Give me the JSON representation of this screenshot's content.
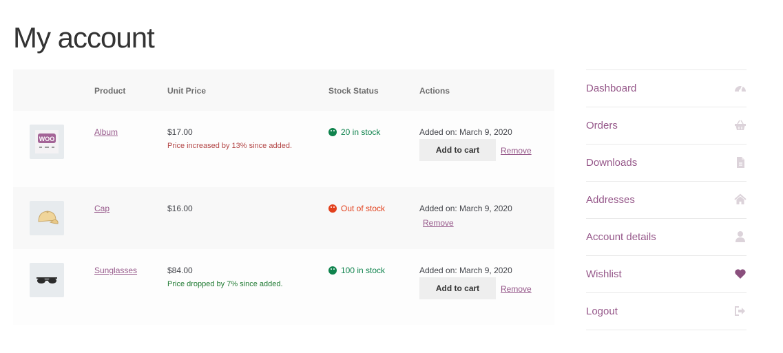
{
  "page": {
    "title": "My account"
  },
  "table": {
    "headers": {
      "product": "Product",
      "unit_price": "Unit Price",
      "stock_status": "Stock Status",
      "actions": "Actions"
    },
    "rows": [
      {
        "image_icon": "album-thumbnail",
        "product": "Album",
        "price": "$17.00",
        "price_note": "Price increased by 13% since added.",
        "stock": "20 in stock",
        "stock_state": "in",
        "added": "Added on: March 9, 2020",
        "add_to_cart": "Add to cart",
        "remove": "Remove"
      },
      {
        "image_icon": "cap-thumbnail",
        "product": "Cap",
        "price": "$16.00",
        "price_note": "",
        "stock": "Out of stock",
        "stock_state": "out",
        "added": "Added on: March 9, 2020",
        "remove": "Remove"
      },
      {
        "image_icon": "sunglasses-thumbnail",
        "product": "Sunglasses",
        "price": "$84.00",
        "price_note": "Price dropped by 7% since added.",
        "stock": "100 in stock",
        "stock_state": "in",
        "added": "Added on: March 9, 2020",
        "add_to_cart": "Add to cart",
        "remove": "Remove"
      }
    ]
  },
  "nav": {
    "items": [
      {
        "label": "Dashboard",
        "icon": "dashboard-icon"
      },
      {
        "label": "Orders",
        "icon": "basket-icon"
      },
      {
        "label": "Downloads",
        "icon": "file-icon"
      },
      {
        "label": "Addresses",
        "icon": "home-icon"
      },
      {
        "label": "Account details",
        "icon": "user-icon"
      },
      {
        "label": "Wishlist",
        "icon": "heart-icon"
      },
      {
        "label": "Logout",
        "icon": "logout-icon"
      }
    ]
  },
  "colors": {
    "link": "#96588a",
    "in_stock": "#0f834d",
    "out_of_stock": "#e2401c",
    "icon_muted": "#d9cfd7",
    "heart": "#8a4f7d"
  }
}
